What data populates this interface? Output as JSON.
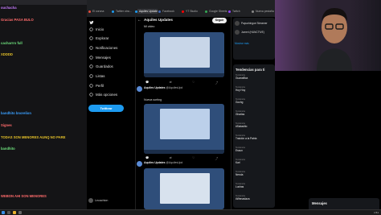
{
  "chat": {
    "lines": [
      {
        "user": "",
        "text": "ouchacha",
        "color": "#c77dff"
      },
      {
        "user": "",
        "text": "Gracias PASA BULO",
        "color": "#ff6b6b"
      },
      {
        "user": "",
        "text": "",
        "color": "#9b9b9b"
      },
      {
        "user": "",
        "text": "cacharrro full",
        "color": "#6ee07d"
      },
      {
        "user": "",
        "text": "XDDDD",
        "color": "#e6c229"
      },
      {
        "user": "",
        "text": "",
        "color": "#3aa0ff"
      },
      {
        "user": "",
        "text": "",
        "color": "#ff8c42"
      },
      {
        "user": "",
        "text": "",
        "color": "#c77dff"
      },
      {
        "user": "",
        "text": "",
        "color": "#6ee07d"
      },
      {
        "user": "",
        "text": "bandhito bnorelion",
        "color": "#3aa0ff"
      },
      {
        "user": "",
        "text": "Signes",
        "color": "#ff6b6b"
      },
      {
        "user": "",
        "text": "TODAS SON MENORES AUNQ NO PARE",
        "color": "#e6c229"
      },
      {
        "user": "",
        "text": "bandhito",
        "color": "#6ee07d"
      },
      {
        "user": "",
        "text": "",
        "color": "#ff8c42"
      },
      {
        "user": "",
        "text": "",
        "color": "#c77dff"
      },
      {
        "user": "",
        "text": "",
        "color": "#3aa0ff"
      },
      {
        "user": "",
        "text": "WEBON AHI SON MENORES",
        "color": "#ff6b6b"
      }
    ]
  },
  "browser": {
    "tabs": [
      {
        "label": "El corona"
      },
      {
        "label": "Twitter otra..."
      },
      {
        "label": "Aquiles Updates"
      },
      {
        "label": "Facebook"
      },
      {
        "label": "YT Studio"
      },
      {
        "label": "Google Sheets"
      },
      {
        "label": "Twitch"
      },
      {
        "label": "Nueva pestaña"
      }
    ]
  },
  "nav": {
    "items": [
      {
        "label": "Inicio",
        "icon": "home-icon"
      },
      {
        "label": "Explorar",
        "icon": "hashtag-icon"
      },
      {
        "label": "Notificaciones",
        "icon": "bell-icon"
      },
      {
        "label": "Mensajes",
        "icon": "mail-icon"
      },
      {
        "label": "Guardados",
        "icon": "bookmark-icon"
      },
      {
        "label": "Listas",
        "icon": "list-icon"
      },
      {
        "label": "Perfil",
        "icon": "person-icon"
      },
      {
        "label": "Más opciones",
        "icon": "more-icon"
      }
    ],
    "tweet_button": "Twittear",
    "account_name": "Lecachion"
  },
  "feed": {
    "title": "Aquiles Updates",
    "follow_label": "Seguir",
    "tweets": [
      {
        "author": "Aquiles Updates",
        "handle": "@AquilesUpd",
        "text": "Mi video",
        "caption": ""
      },
      {
        "author": "Aquiles Updates",
        "handle": "@AquilesUpd",
        "text": "",
        "caption": "Nueva sorting"
      },
      {
        "author": "Aquiles Updates",
        "handle": "@AquilesUpd",
        "text": "",
        "caption": ""
      }
    ]
  },
  "who_to_follow": {
    "items": [
      {
        "name": "Papuchingue Streamer"
      },
      {
        "name": "Jumeri (HUNCTIVE)"
      },
      {
        "name": "Mostrar más"
      }
    ]
  },
  "trends": {
    "title": "Tendencias para ti",
    "items": [
      {
        "context": "Tendencia",
        "name": "Guanaflica"
      },
      {
        "context": "Tendencia",
        "name": "Hoy Hoy"
      },
      {
        "context": "Tendencia",
        "name": "Gochg"
      },
      {
        "context": "Tendencia",
        "name": "Gharlas"
      },
      {
        "context": "Tendencia",
        "name": "#Sabadito"
      },
      {
        "context": "Tendencia",
        "name": "Traición a la Patria"
      },
      {
        "context": "Tendencia",
        "name": "Essun"
      },
      {
        "context": "Tendencia",
        "name": "Karl"
      },
      {
        "context": "Tendencia",
        "name": "Nerola"
      },
      {
        "context": "Tendencia",
        "name": "Luchas"
      },
      {
        "context": "Tendencia",
        "name": "#Wenaslaza"
      }
    ]
  },
  "messages_label": "Mensajes",
  "taskbar": {
    "time": "1:51"
  },
  "colors": {
    "accent": "#1d9bf0",
    "background": "#000000"
  }
}
